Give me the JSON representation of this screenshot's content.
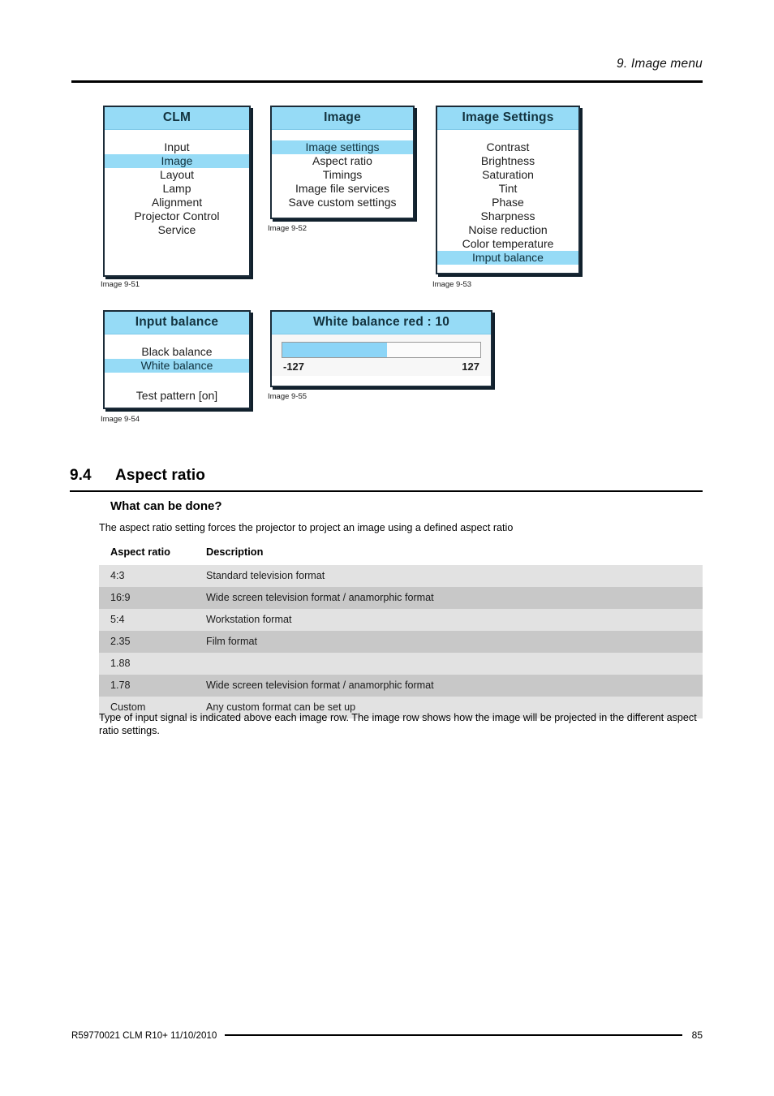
{
  "header": {
    "running_title": "9.  Image menu"
  },
  "figures": [
    {
      "id": "clm-menu",
      "caption": "Image 9-51",
      "title": "CLM",
      "items": [
        {
          "label": "Input",
          "selected": false
        },
        {
          "label": "Image",
          "selected": true
        },
        {
          "label": "Layout",
          "selected": false
        },
        {
          "label": "Lamp",
          "selected": false
        },
        {
          "label": "Alignment",
          "selected": false
        },
        {
          "label": "Projector Control",
          "selected": false
        },
        {
          "label": "Service",
          "selected": false
        }
      ]
    },
    {
      "id": "image-menu",
      "caption": "Image 9-52",
      "title": "Image",
      "items": [
        {
          "label": "Image settings",
          "selected": true
        },
        {
          "label": "Aspect ratio",
          "selected": false
        },
        {
          "label": "Timings",
          "selected": false
        },
        {
          "label": "Image file services",
          "selected": false
        },
        {
          "label": "Save custom settings",
          "selected": false
        }
      ]
    },
    {
      "id": "image-settings-menu",
      "caption": "Image 9-53",
      "title": "Image Settings",
      "items": [
        {
          "label": "Contrast",
          "selected": false
        },
        {
          "label": "Brightness",
          "selected": false
        },
        {
          "label": "Saturation",
          "selected": false
        },
        {
          "label": "Tint",
          "selected": false
        },
        {
          "label": "Phase",
          "selected": false
        },
        {
          "label": "Sharpness",
          "selected": false
        },
        {
          "label": "Noise reduction",
          "selected": false
        },
        {
          "label": "Color temperature",
          "selected": false
        },
        {
          "label": "Imput balance",
          "selected": true
        }
      ]
    },
    {
      "id": "input-balance-menu",
      "caption": "Image 9-54",
      "title": "Input balance",
      "items": [
        {
          "label": "Black balance",
          "selected": false
        },
        {
          "label": "White balance",
          "selected": true
        },
        {
          "label": "Test pattern [on]",
          "selected": false
        }
      ]
    },
    {
      "id": "white-balance-red-slider",
      "caption": "Image 9-55",
      "title": "White balance red : 10",
      "slider": {
        "min_label": "-127",
        "max_label": "127",
        "fill_percent": 53
      }
    }
  ],
  "section": {
    "number": "9.4",
    "title": "Aspect ratio",
    "subheading": "What can be done?",
    "intro": "The aspect ratio setting forces the projector to project an image using a defined aspect ratio",
    "after_table": "Type of input signal is indicated above each image row.  The image row shows how the image will be projected in the different aspect ratio settings."
  },
  "table": {
    "headers": [
      "Aspect ratio",
      "Description"
    ],
    "rows": [
      {
        "ratio": "4:3",
        "description": "Standard television format"
      },
      {
        "ratio": "16:9",
        "description": "Wide screen television format / anamorphic format"
      },
      {
        "ratio": "5:4",
        "description": "Workstation format"
      },
      {
        "ratio": "2.35",
        "description": "Film format"
      },
      {
        "ratio": "1.88",
        "description": ""
      },
      {
        "ratio": "1.78",
        "description": "Wide screen television format / anamorphic format"
      },
      {
        "ratio": "Custom",
        "description": "Any custom format can be set up"
      }
    ]
  },
  "footer": {
    "left": "R59770021   CLM R10+   11/10/2010",
    "page": "85"
  },
  "colors": {
    "osd_highlight": "#96dbf6",
    "osd_border": "#1b2b38",
    "table_row_odd": "#e2e2e2",
    "table_row_even": "#c8c8c8",
    "slider_fill": "#8cd5f7"
  }
}
